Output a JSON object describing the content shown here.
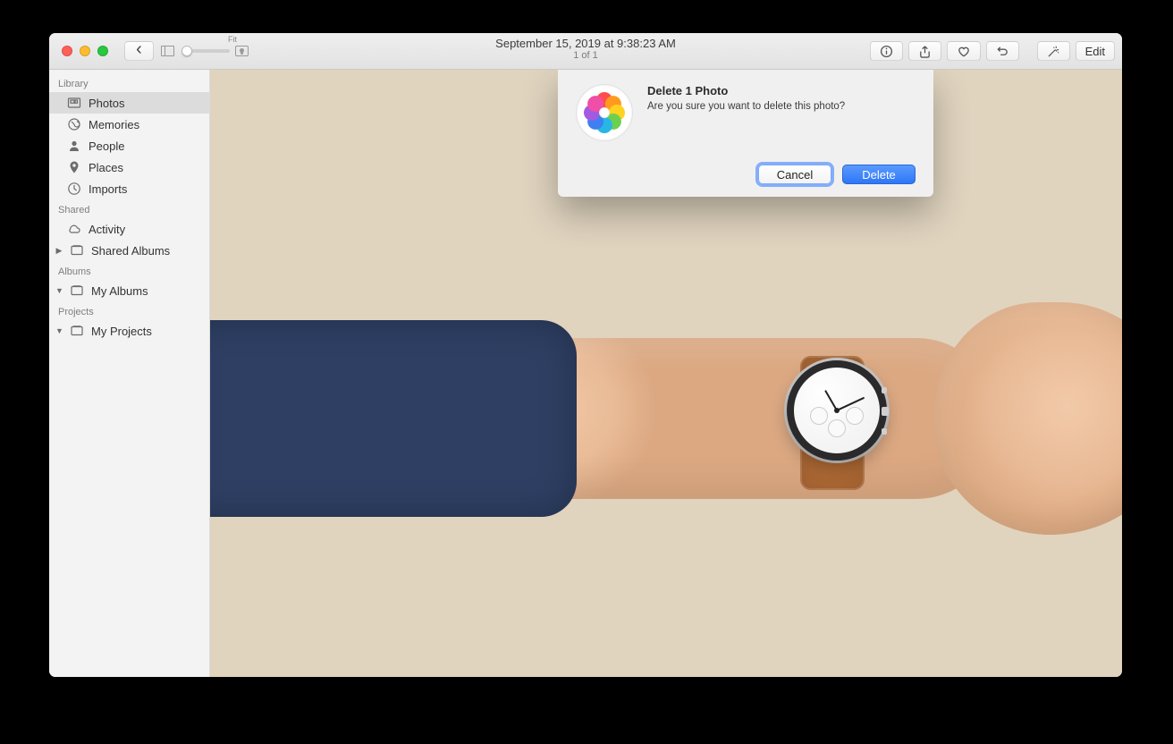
{
  "titlebar": {
    "title": "September 15, 2019 at 9:38:23 AM",
    "subtitle": "1 of 1",
    "zoom_label": "Fit",
    "edit_label": "Edit"
  },
  "sidebar": {
    "sections": {
      "library": {
        "title": "Library"
      },
      "shared": {
        "title": "Shared"
      },
      "albums": {
        "title": "Albums"
      },
      "projects": {
        "title": "Projects"
      }
    },
    "library_items": [
      {
        "label": "Photos",
        "icon": "photos-icon",
        "selected": true
      },
      {
        "label": "Memories",
        "icon": "memories-icon"
      },
      {
        "label": "People",
        "icon": "people-icon"
      },
      {
        "label": "Places",
        "icon": "places-icon"
      },
      {
        "label": "Imports",
        "icon": "imports-icon"
      }
    ],
    "shared_items": [
      {
        "label": "Activity",
        "icon": "cloud-icon"
      },
      {
        "label": "Shared Albums",
        "icon": "album-icon",
        "disclosure": "right"
      }
    ],
    "albums_items": [
      {
        "label": "My Albums",
        "icon": "album-icon",
        "disclosure": "down"
      }
    ],
    "projects_items": [
      {
        "label": "My Projects",
        "icon": "album-icon",
        "disclosure": "down"
      }
    ]
  },
  "dialog": {
    "title": "Delete 1 Photo",
    "message": "Are you sure you want to delete this photo?",
    "cancel_label": "Cancel",
    "confirm_label": "Delete"
  }
}
